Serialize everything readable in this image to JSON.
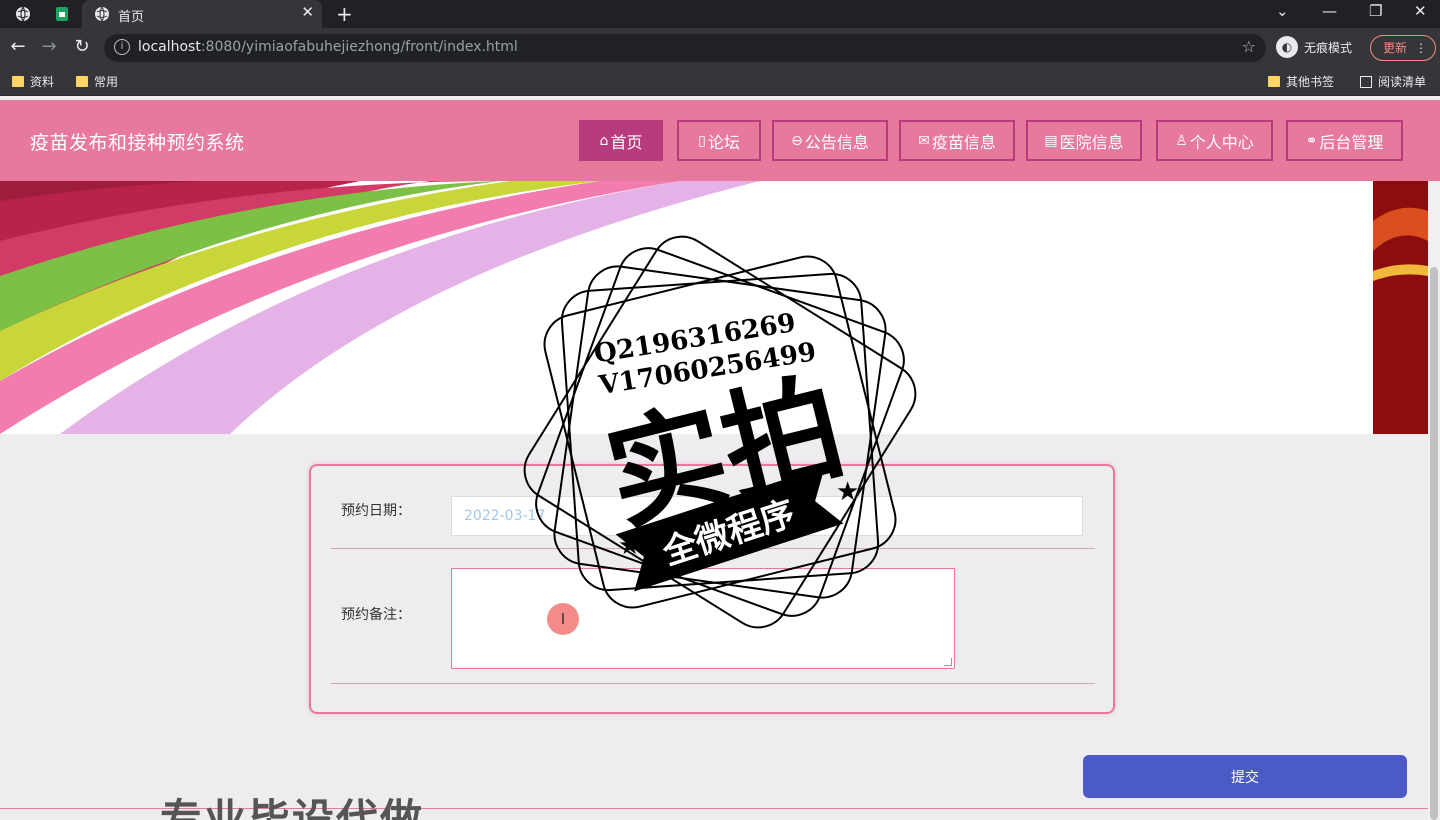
{
  "browser": {
    "tab_title": "首页",
    "url_host": "localhost",
    "url_path": ":8080/yimiaofabuhejiezhong/front/index.html",
    "incognito_label": "无痕模式",
    "update_label": "更新",
    "bookmarks": [
      "资料",
      "常用"
    ],
    "other_bookmarks": "其他书签",
    "reading_list": "阅读清单"
  },
  "site": {
    "title": "疫苗发布和接种预约系统",
    "menu": [
      {
        "label": "首页",
        "icon": "home-icon",
        "glyph": "⌂"
      },
      {
        "label": "论坛",
        "icon": "note-icon",
        "glyph": "▯"
      },
      {
        "label": "公告信息",
        "icon": "announcement-icon",
        "glyph": "⊖"
      },
      {
        "label": "疫苗信息",
        "icon": "mail-icon",
        "glyph": "✉"
      },
      {
        "label": "医院信息",
        "icon": "document-icon",
        "glyph": "▤"
      },
      {
        "label": "个人中心",
        "icon": "user-icon",
        "glyph": "♙"
      },
      {
        "label": "后台管理",
        "icon": "link-icon",
        "glyph": "⚭"
      }
    ]
  },
  "form": {
    "date_label": "预约日期：",
    "date_value": "2022-03-17",
    "note_label": "预约备注：",
    "note_value": "",
    "submit_label": "提交"
  },
  "watermark": {
    "qq": "Q2196316269",
    "wechat": "V17060256499",
    "main": "实拍",
    "ribbon": "全微程序"
  },
  "bottom_ad": "专业毕设代做",
  "colors": {
    "header_pink": "#e77a9c",
    "menu_magenta": "#b73b7d",
    "submit_blue": "#4b5bc6"
  }
}
